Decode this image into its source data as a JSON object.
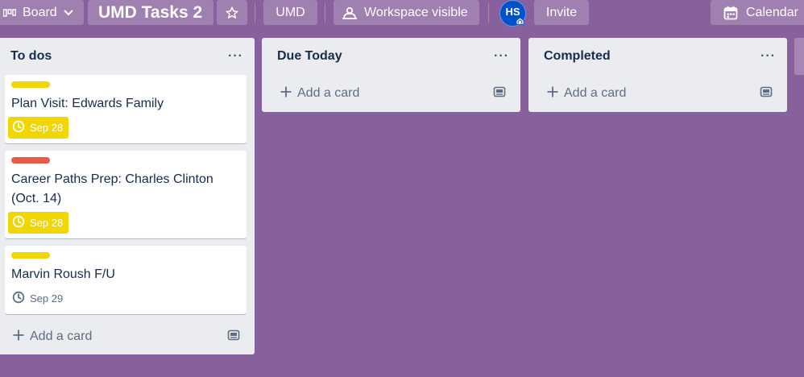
{
  "header": {
    "view_switcher_label": "Board",
    "board_title": "UMD Tasks 2",
    "workspace_label": "UMD",
    "visibility_label": "Workspace visible",
    "avatar_initials": "HS",
    "invite_label": "Invite",
    "calendar_label": "Calendar"
  },
  "lists": [
    {
      "title": "To dos",
      "more": "···",
      "add_card_label": "Add a card",
      "cards": [
        {
          "label_color": "#f2d600",
          "title": "Plan Visit: Edwards Family",
          "due": "Sep 28",
          "due_style": "due-soon"
        },
        {
          "label_color": "#eb5a46",
          "title": "Career Paths Prep: Charles Clinton (Oct. 14)",
          "due": "Sep 28",
          "due_style": "due-soon"
        },
        {
          "label_color": "#f2d600",
          "title": "Marvin Roush F/U",
          "due": "Sep 29",
          "due_style": "normal"
        }
      ]
    },
    {
      "title": "Due Today",
      "more": "···",
      "add_card_label": "Add a card",
      "cards": []
    },
    {
      "title": "Completed",
      "more": "···",
      "add_card_label": "Add a card",
      "cards": []
    }
  ],
  "colors": {
    "board_bg": "#89609e",
    "list_bg": "#ebecf0",
    "due_soon_bg": "#f2d600",
    "label_yellow": "#f2d600",
    "label_red": "#eb5a46",
    "avatar_bg": "#0052cc"
  },
  "icons": {
    "board_view": "board-icon",
    "chevron": "chevron-down-icon",
    "star": "star-icon",
    "visibility": "people-icon",
    "calendar": "calendar-icon",
    "clock": "clock-icon",
    "plus": "plus-icon",
    "template": "template-icon",
    "admin": "admin-badge-icon"
  }
}
